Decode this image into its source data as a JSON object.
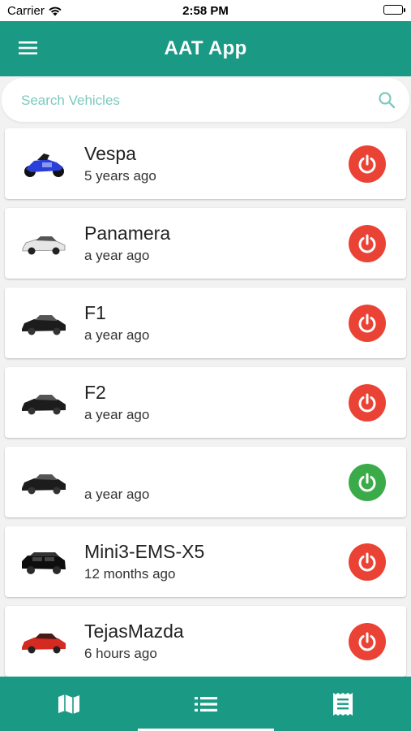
{
  "status_bar": {
    "carrier": "Carrier",
    "time": "2:58 PM"
  },
  "app_bar": {
    "title": "AAT App",
    "menu_icon": "hamburger-menu-icon"
  },
  "search": {
    "placeholder": "Search Vehicles",
    "value": "",
    "icon": "search-icon"
  },
  "vehicles": [
    {
      "name": "Vespa",
      "last_seen": "5 years ago",
      "thumbnail": "blue motorcycle",
      "power": "off"
    },
    {
      "name": "Panamera",
      "last_seen": "a year ago",
      "thumbnail": "white car",
      "power": "off"
    },
    {
      "name": "F1",
      "last_seen": "a year ago",
      "thumbnail": "black car",
      "power": "off"
    },
    {
      "name": "F2",
      "last_seen": "a year ago",
      "thumbnail": "black car",
      "power": "off"
    },
    {
      "name": "",
      "last_seen": "a year ago",
      "thumbnail": "black car",
      "power": "on"
    },
    {
      "name": "Mini3-EMS-X5",
      "last_seen": "12 months ago",
      "thumbnail": "black suv",
      "power": "off"
    },
    {
      "name": "TejasMazda",
      "last_seen": "6 hours ago",
      "thumbnail": "red car",
      "power": "off"
    }
  ],
  "colors": {
    "primary": "#1a9a85",
    "power_off": "#ea4335",
    "power_on": "#3bab49",
    "search_placeholder": "#7cc9bd"
  },
  "bottom_nav": {
    "tabs": [
      {
        "icon": "map-icon"
      },
      {
        "icon": "list-icon",
        "selected": true
      },
      {
        "icon": "receipt-icon"
      }
    ]
  }
}
